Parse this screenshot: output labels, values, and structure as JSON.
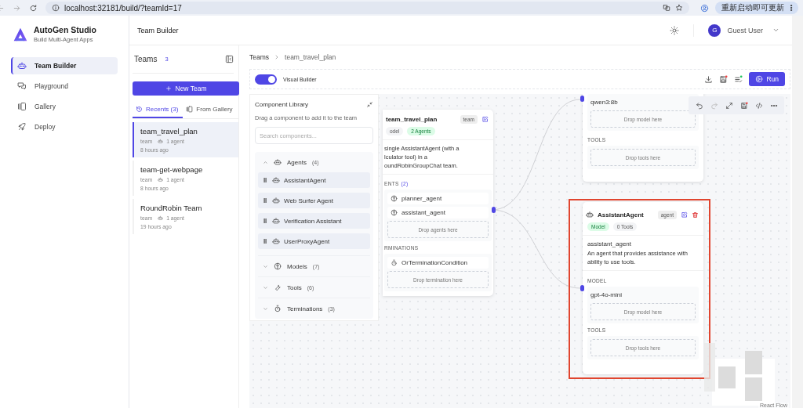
{
  "browser": {
    "address": "localhost:32181/build/?teamId=17",
    "update_button": "重新启动即可更新"
  },
  "sidebar": {
    "app_title": "AutoGen Studio",
    "app_subtitle": "Build Multi-Agent Apps",
    "items": [
      {
        "label": "Team Builder",
        "selected": true
      },
      {
        "label": "Playground",
        "selected": false
      },
      {
        "label": "Gallery",
        "selected": false
      },
      {
        "label": "Deploy",
        "selected": false
      }
    ]
  },
  "header": {
    "title": "Team Builder",
    "user": {
      "initial": "G",
      "name": "Guest User"
    }
  },
  "teams_panel": {
    "title": "Teams",
    "count": "3",
    "new_button": "New Team",
    "tabs": [
      {
        "label": "Recents (3)",
        "selected": true
      },
      {
        "label": "From Gallery",
        "selected": false
      }
    ],
    "teams": [
      {
        "name": "team_travel_plan",
        "type": "team",
        "agents": "1 agent",
        "time": "8 hours ago",
        "selected": true
      },
      {
        "name": "team-get-webpage",
        "type": "team",
        "agents": "1 agent",
        "time": "8 hours ago",
        "selected": false
      },
      {
        "name": "RoundRobin Team",
        "type": "team",
        "agents": "1 agent",
        "time": "19 hours ago",
        "selected": false
      }
    ]
  },
  "builder": {
    "breadcrumb": [
      "Teams",
      "team_travel_plan"
    ],
    "visual_builder": {
      "label": "Visual Builder",
      "on": true
    },
    "run_button": "Run",
    "library": {
      "title": "Component Library",
      "hint": "Drag a component to add it to the team",
      "search": {
        "placeholder": "Search components..."
      },
      "sections": [
        {
          "label": "Agents",
          "count": "(4)",
          "expanded": true,
          "items": [
            "AssistantAgent",
            "Web Surfer Agent",
            "Verification Assistant",
            "UserProxyAgent"
          ]
        },
        {
          "label": "Models",
          "count": "(7)",
          "expanded": false
        },
        {
          "label": "Tools",
          "count": "(6)",
          "expanded": false
        },
        {
          "label": "Terminations",
          "count": "(3)",
          "expanded": false
        }
      ]
    },
    "team_node": {
      "title": "team_travel_plan",
      "badge": "team",
      "tags": [
        {
          "label": "odel",
          "kind": "grey"
        },
        {
          "label": "2 Agents",
          "kind": "green"
        }
      ],
      "description_lines": [
        "single AssistantAgent (with a",
        "lculator tool) in a",
        "oundRobinGroupChat team."
      ],
      "agents_heading": "ENTS",
      "agents_count": "(2)",
      "agents": [
        "planner_agent",
        "assistant_agent"
      ],
      "agents_drop": "Drop agents here",
      "terminations_heading": "RMINATIONS",
      "terminations": [
        "OrTerminationCondition"
      ],
      "terminations_drop": "Drop termination here"
    },
    "model_node": {
      "model": "qwen3:8b",
      "model_drop": "Drop model here",
      "tools_heading": "TOOLS",
      "tools_drop": "Drop tools here"
    },
    "agent_node": {
      "title": "AssistantAgent",
      "badge": "agent",
      "highlighted": true,
      "tags": [
        {
          "label": "Model",
          "kind": "green"
        },
        {
          "label": "0 Tools",
          "kind": "grey"
        }
      ],
      "name": "assistant_agent",
      "description": "An agent that provides assistance with ability to use tools.",
      "model_heading": "MODEL",
      "model": "gpt-4o-mini",
      "model_drop": "Drop model here",
      "tools_heading": "TOOLS",
      "tools_drop": "Drop tools here"
    },
    "attribution": "React Flow"
  }
}
